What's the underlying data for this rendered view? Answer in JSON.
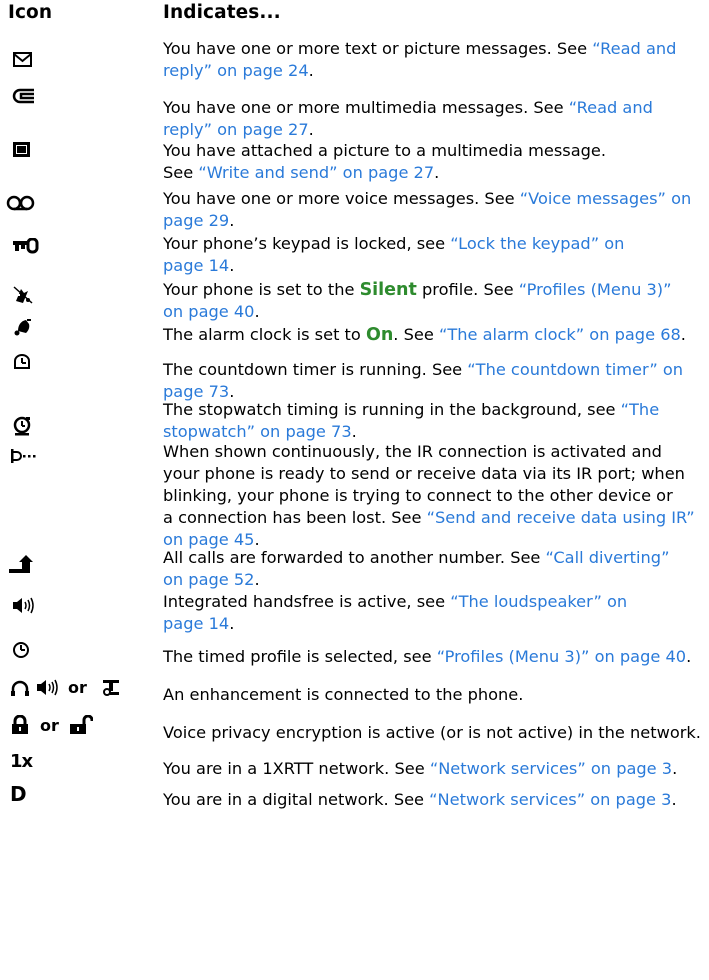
{
  "header": {
    "icon_col": "Icon",
    "indicates_col": "Indicates..."
  },
  "rows": [
    {
      "icon": "envelope-message-icon",
      "lines": [
        [
          [
            "You have one or more text or picture messages. See ",
            ""
          ],
          [
            "“Read and",
            "link"
          ]
        ],
        [
          [
            "reply” on page 24",
            "link"
          ],
          [
            ".",
            ""
          ]
        ]
      ]
    },
    {
      "icon": "multimedia-message-icon",
      "lines": [
        [
          [
            "You have one or more multimedia messages. See ",
            ""
          ],
          [
            "“Read and",
            "link"
          ]
        ],
        [
          [
            "reply” on page 27",
            "link"
          ],
          [
            ".",
            ""
          ]
        ]
      ]
    },
    {
      "icon": "picture-attached-icon",
      "lines": [
        [
          [
            "You have attached a picture to a multimedia message.",
            ""
          ]
        ],
        [
          [
            "See ",
            ""
          ],
          [
            "“Write and send” on page 27",
            "link"
          ],
          [
            ".",
            ""
          ]
        ]
      ]
    },
    {
      "icon": "voicemail-icon",
      "lines": [
        [
          [
            "You have one or more voice messages. See ",
            ""
          ],
          [
            "“Voice messages” on",
            "link"
          ]
        ],
        [
          [
            "page 29",
            "link"
          ],
          [
            ".",
            ""
          ]
        ]
      ]
    },
    {
      "icon": "keypad-lock-icon",
      "lines": [
        [
          [
            "Your phone’s keypad is locked, see ",
            ""
          ],
          [
            "“Lock the keypad” on",
            "link"
          ]
        ],
        [
          [
            "page 14",
            "link"
          ],
          [
            ".",
            ""
          ]
        ]
      ]
    },
    {
      "icon": "silent-profile-icon",
      "lines": [
        [
          [
            "Your phone is set to the ",
            ""
          ],
          [
            "Silent",
            "em"
          ],
          [
            " profile. See ",
            ""
          ],
          [
            "“Profiles (Menu 3)”",
            "link"
          ]
        ],
        [
          [
            "on page 40",
            "link"
          ],
          [
            ".",
            ""
          ]
        ]
      ]
    },
    {
      "icon": "alarm-bell-icon",
      "lines": [
        [
          [
            "The alarm clock is set to ",
            ""
          ],
          [
            "On",
            "em"
          ],
          [
            ". See ",
            ""
          ],
          [
            "“The alarm clock” on page 68",
            "link"
          ],
          [
            ".",
            ""
          ]
        ]
      ]
    },
    {
      "icon": "countdown-timer-icon",
      "lines": [
        [
          [
            "The countdown timer is running. See ",
            ""
          ],
          [
            "“The countdown timer” on",
            "link"
          ]
        ],
        [
          [
            "page 73",
            "link"
          ],
          [
            ".",
            ""
          ]
        ]
      ]
    },
    {
      "icon": "stopwatch-icon",
      "lines": [
        [
          [
            "The stopwatch timing is running in the background, see ",
            ""
          ],
          [
            "“The",
            "link"
          ]
        ],
        [
          [
            "stopwatch” on page 73",
            "link"
          ],
          [
            ".",
            ""
          ]
        ]
      ]
    },
    {
      "icon": "ir-connection-icon",
      "lines": [
        [
          [
            "When shown continuously, the IR connection is activated and",
            ""
          ]
        ],
        [
          [
            "your phone is ready to send or receive data via its IR port; when",
            ""
          ]
        ],
        [
          [
            "blinking, your phone is trying to connect to the other device or",
            ""
          ]
        ],
        [
          [
            "a connection has been lost. See ",
            ""
          ],
          [
            "“Send and receive data using IR”",
            "link"
          ]
        ],
        [
          [
            "on page 45",
            "link"
          ],
          [
            ".",
            ""
          ]
        ]
      ]
    },
    {
      "icon": "call-forward-icon",
      "lines": [
        [
          [
            "All calls are forwarded to another number. See ",
            ""
          ],
          [
            "“Call diverting”",
            "link"
          ]
        ],
        [
          [
            "on page 52",
            "link"
          ],
          [
            ".",
            ""
          ]
        ]
      ]
    },
    {
      "icon": "loudspeaker-icon",
      "lines": [
        [
          [
            "Integrated handsfree is active, see ",
            ""
          ],
          [
            "“The loudspeaker” on",
            "link"
          ]
        ],
        [
          [
            "page 14",
            "link"
          ],
          [
            ".",
            ""
          ]
        ]
      ]
    },
    {
      "icon": "timed-profile-icon",
      "lines": [
        [
          [
            "The timed profile is selected, see ",
            ""
          ],
          [
            "“Profiles (Menu 3)” on page 40",
            "link"
          ],
          [
            ".",
            ""
          ]
        ]
      ]
    },
    {
      "icon": "enhancement-icons",
      "or_words": [
        "or",
        "or"
      ],
      "lines": [
        [
          [
            "An enhancement is connected to the phone.",
            ""
          ]
        ]
      ]
    },
    {
      "icon": "encryption-lock-icons",
      "or_words": [
        "or"
      ],
      "lines": [
        [
          [
            "Voice privacy encryption is active (or is not active) in the network.",
            ""
          ]
        ]
      ]
    },
    {
      "icon": "1xrtt-network-icon",
      "glyph_text": "1x",
      "lines": [
        [
          [
            "You are in a 1XRTT network. See ",
            ""
          ],
          [
            "“Network services” on page 3",
            "link"
          ],
          [
            ".",
            ""
          ]
        ]
      ]
    },
    {
      "icon": "digital-network-icon",
      "glyph_text": "D",
      "lines": [
        [
          [
            "You are in a digital network. See ",
            ""
          ],
          [
            "“Network services” on page 3",
            "link"
          ],
          [
            ".",
            ""
          ]
        ]
      ]
    }
  ],
  "colors": {
    "link": "#2a7ad9",
    "emphasis": "#2e8b2e",
    "text": "#000000"
  }
}
